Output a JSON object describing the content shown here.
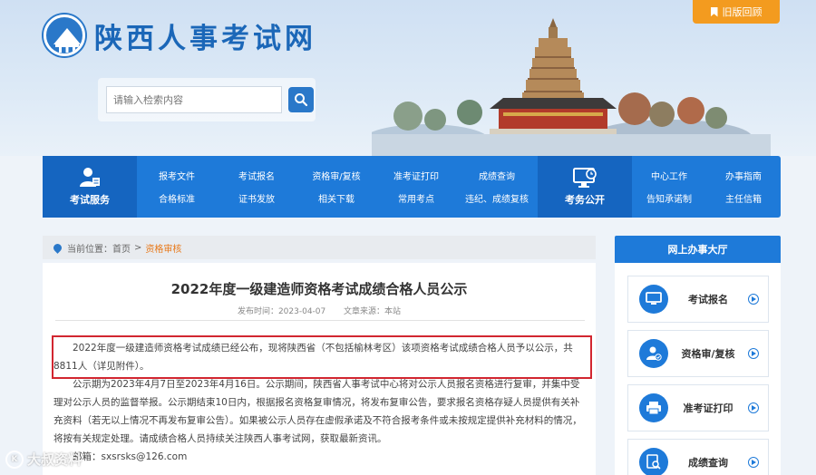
{
  "header": {
    "site_title": "陕西人事考试网",
    "old_version_label": "旧版回顾",
    "search_placeholder": "请输入检索内容"
  },
  "nav": {
    "exam_service_label": "考试服务",
    "exam_affairs_label": "考务公开",
    "columns": [
      {
        "top": "报考文件",
        "bottom": "合格标准"
      },
      {
        "top": "考试报名",
        "bottom": "证书发放"
      },
      {
        "top": "资格审/复核",
        "bottom": "相关下载"
      },
      {
        "top": "准考证打印",
        "bottom": "常用考点"
      },
      {
        "top": "成绩查询",
        "bottom": "违纪、成绩复核"
      },
      {
        "top": "中心工作",
        "bottom": "告知承诺制"
      },
      {
        "top": "办事指南",
        "bottom": "主任信箱"
      }
    ]
  },
  "breadcrumb": {
    "prefix": "当前位置：",
    "home": "首页",
    "separator": ">",
    "current": "资格审核"
  },
  "article": {
    "title": "2022年度一级建造师资格考试成绩合格人员公示",
    "publish_time": "发布时间：2023-04-07",
    "source": "文章来源：本站",
    "paragraph1": "2022年度一级建造师资格考试成绩已经公布，现将陕西省（不包括榆林考区）该项资格考试成绩合格人员予以公示，共8811人（详见附件）。",
    "paragraph2": "公示期为2023年4月7日至2023年4月16日。公示期间，陕西省人事考试中心将对公示人员报名资格进行复审，并集中受理对公示人员的监督举报。公示期结束10日内，根据报名资格复审情况，将发布复审公告，要求报名资格存疑人员提供有关补充资料（若无以上情况不再发布复审公告）。如果被公示人员存在虚假承诺及不符合报考条件或未按规定提供补充材料的情况，将按有关规定处理。请成绩合格人员持续关注陕西人事考试网，获取最新资讯。",
    "email_line": "邮箱：sxsrsks@126.com"
  },
  "watermark": {
    "text": "大叔资料"
  },
  "sidebar": {
    "title": "网上办事大厅",
    "items": [
      {
        "label": "考试报名",
        "icon": "monitor-icon"
      },
      {
        "label": "资格审/复核",
        "icon": "user-check-icon"
      },
      {
        "label": "准考证打印",
        "icon": "printer-icon"
      },
      {
        "label": "成绩查询",
        "icon": "search-doc-icon"
      }
    ]
  },
  "colors": {
    "primary_blue": "#1e7ad9",
    "dark_blue": "#1565c0",
    "orange": "#f39b1f",
    "highlight_red": "#d22630"
  }
}
